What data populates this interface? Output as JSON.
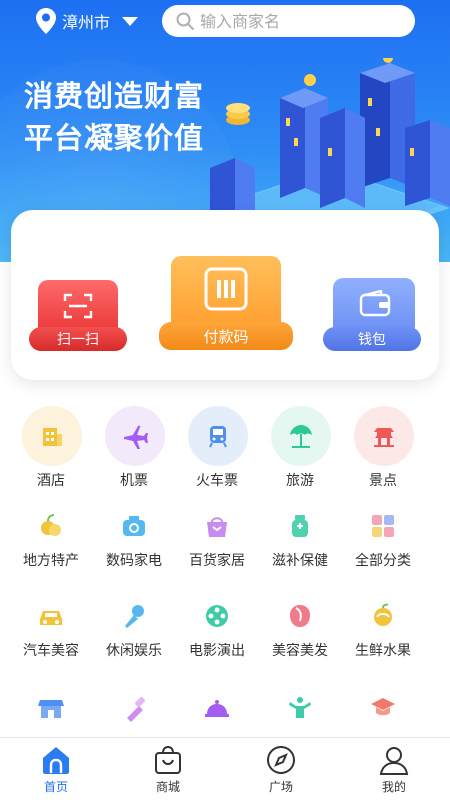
{
  "header": {
    "city": "漳州市",
    "search_placeholder": "输入商家名"
  },
  "banner": {
    "slogan_line1": "消费创造财富",
    "slogan_line2": "平台凝聚价值"
  },
  "actions": {
    "scan": "扫一扫",
    "pay": "付款码",
    "wallet": "钱包"
  },
  "categories_main": [
    {
      "label": "酒店",
      "icon": "hotel-icon",
      "bg": "#fdf3dc",
      "color": "#f4c23a"
    },
    {
      "label": "机票",
      "icon": "airplane-icon",
      "bg": "#f2e9fb",
      "color": "#a45df0"
    },
    {
      "label": "火车票",
      "icon": "train-icon",
      "bg": "#e4eefb",
      "color": "#4f8ff2"
    },
    {
      "label": "旅游",
      "icon": "beach-umbrella-icon",
      "bg": "#e4f7f0",
      "color": "#2ec796"
    },
    {
      "label": "景点",
      "icon": "landmark-icon",
      "bg": "#fde8e8",
      "color": "#f05757"
    }
  ],
  "categories_row2": [
    {
      "label": "地方特产",
      "icon": "produce-icon",
      "color": "#f0c43c"
    },
    {
      "label": "数码家电",
      "icon": "camera-icon",
      "color": "#56b8f0"
    },
    {
      "label": "百货家居",
      "icon": "gift-bag-icon",
      "color": "#c78cf0"
    },
    {
      "label": "滋补保健",
      "icon": "supplement-bottle-icon",
      "color": "#4fd2b0"
    },
    {
      "label": "全部分类",
      "icon": "grid-categories-icon",
      "color": "#f5a5b5"
    }
  ],
  "categories_row3": [
    {
      "label": "汽车美容",
      "icon": "car-icon",
      "color": "#f4c23a"
    },
    {
      "label": "休闲娱乐",
      "icon": "microphone-icon",
      "color": "#56b8f0"
    },
    {
      "label": "电影演出",
      "icon": "film-reel-icon",
      "color": "#3fcba8"
    },
    {
      "label": "美容美发",
      "icon": "beauty-face-icon",
      "color": "#f07a8a"
    },
    {
      "label": "生鲜水果",
      "icon": "fruit-icon",
      "color": "#f0c43c"
    }
  ],
  "categories_row4": [
    {
      "icon": "store-icon",
      "color": "#4f8ff2"
    },
    {
      "icon": "cosmetics-icon",
      "color": "#d08cf0"
    },
    {
      "icon": "service-bell-icon",
      "color": "#a45df0"
    },
    {
      "icon": "fitness-icon",
      "color": "#3fcba8"
    },
    {
      "icon": "graduation-cap-icon",
      "color": "#f07a6a"
    }
  ],
  "bottom_nav": [
    {
      "label": "首页",
      "icon": "home-icon",
      "active": true
    },
    {
      "label": "商城",
      "icon": "shopping-bag-icon",
      "active": false
    },
    {
      "label": "广场",
      "icon": "compass-icon",
      "active": false
    },
    {
      "label": "我的",
      "icon": "user-icon",
      "active": false
    }
  ]
}
